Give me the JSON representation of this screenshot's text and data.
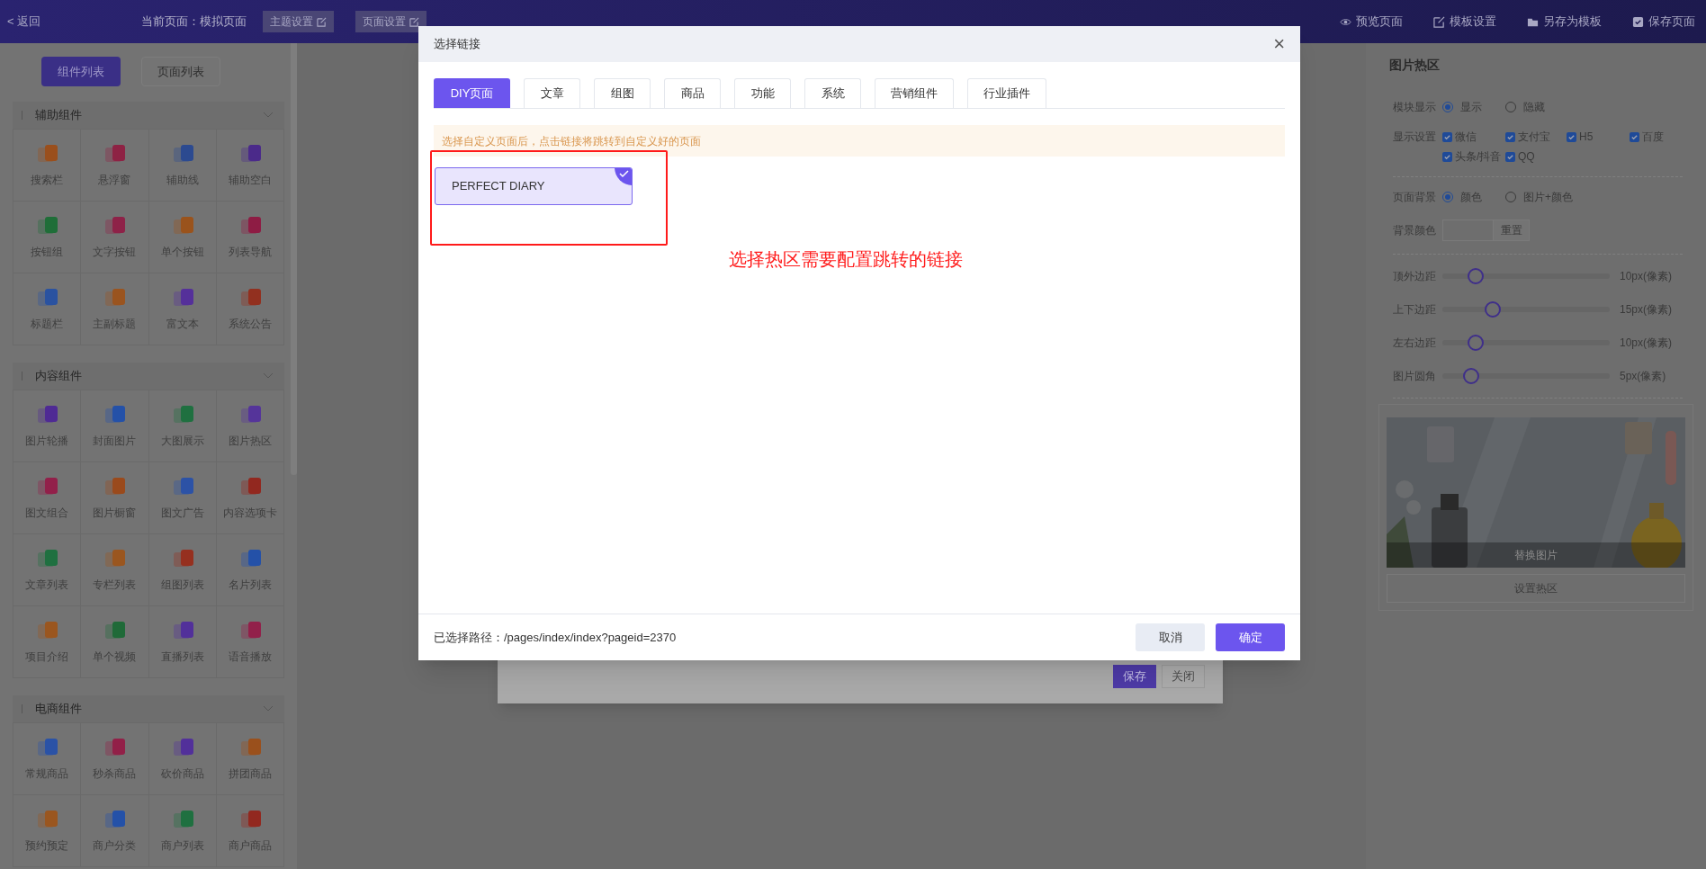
{
  "top_bar": {
    "back": "< 返回",
    "current_page": "当前页面：模拟页面",
    "page_buttons": [
      "主题设置",
      "页面设置"
    ],
    "actions": [
      {
        "label": "预览页面",
        "kind": "eye"
      },
      {
        "label": "模板设置",
        "kind": "edit"
      },
      {
        "label": "另存为模板",
        "kind": "folder"
      },
      {
        "label": "保存页面",
        "kind": "check"
      }
    ]
  },
  "sidebar": {
    "tabs": [
      {
        "label": "组件列表",
        "selected": true
      },
      {
        "label": "页面列表",
        "selected": false
      }
    ],
    "sections": [
      {
        "title": "辅助组件",
        "expanded": true,
        "items": [
          {
            "label": "搜索栏",
            "color": "#9a4f1c"
          },
          {
            "label": "悬浮窗",
            "color": "#8e2244"
          },
          {
            "label": "辅助线",
            "color": "#2c4a90"
          },
          {
            "label": "辅助空白",
            "color": "#4b2a8a"
          },
          {
            "label": "按钮组",
            "color": "#1f6e38"
          },
          {
            "label": "文字按钮",
            "color": "#8e2248"
          },
          {
            "label": "单个按钮",
            "color": "#9a531c"
          },
          {
            "label": "列表导航",
            "color": "#8e1c44"
          },
          {
            "label": "标题栏",
            "color": "#2a52a0"
          },
          {
            "label": "主副标题",
            "color": "#9a541f"
          },
          {
            "label": "富文本",
            "color": "#55309a"
          },
          {
            "label": "系统公告",
            "color": "#92301f"
          }
        ]
      },
      {
        "title": "内容组件",
        "expanded": true,
        "items": [
          {
            "label": "图片轮播",
            "color": "#4f2a94"
          },
          {
            "label": "封面图片",
            "color": "#2451a8"
          },
          {
            "label": "大图展示",
            "color": "#1f7040"
          },
          {
            "label": "图片热区",
            "color": "#55349a"
          },
          {
            "label": "图文组合",
            "color": "#92204a"
          },
          {
            "label": "图片橱窗",
            "color": "#9a4a1c"
          },
          {
            "label": "图文广告",
            "color": "#2c52a6"
          },
          {
            "label": "内容选项卡",
            "color": "#92281f"
          },
          {
            "label": "文章列表",
            "color": "#1f7040"
          },
          {
            "label": "专栏列表",
            "color": "#9a561f"
          },
          {
            "label": "组图列表",
            "color": "#96301f"
          },
          {
            "label": "名片列表",
            "color": "#2451a8"
          },
          {
            "label": "项目介绍",
            "color": "#9a561f"
          },
          {
            "label": "单个视频",
            "color": "#1f6a38"
          },
          {
            "label": "直播列表",
            "color": "#52309a"
          },
          {
            "label": "语音播放",
            "color": "#92204a"
          }
        ]
      },
      {
        "title": "电商组件",
        "expanded": true,
        "items": [
          {
            "label": "常规商品",
            "color": "#2a52a6"
          },
          {
            "label": "秒杀商品",
            "color": "#922048"
          },
          {
            "label": "砍价商品",
            "color": "#52309a"
          },
          {
            "label": "拼团商品",
            "color": "#9a501c"
          },
          {
            "label": "预约预定",
            "color": "#9a561f"
          },
          {
            "label": "商户分类",
            "color": "#2451a8"
          },
          {
            "label": "商户列表",
            "color": "#1f7040"
          },
          {
            "label": "商户商品",
            "color": "#92281f"
          }
        ]
      }
    ]
  },
  "background_dialog": {
    "buttons": [
      {
        "label": "保存",
        "kind": "primary"
      },
      {
        "label": "关闭",
        "kind": "default"
      }
    ]
  },
  "modal": {
    "title": "选择链接",
    "close": "×",
    "tabs": [
      {
        "label": "DIY页面",
        "selected": true
      },
      {
        "label": "文章",
        "selected": false
      },
      {
        "label": "组图",
        "selected": false
      },
      {
        "label": "商品",
        "selected": false
      },
      {
        "label": "功能",
        "selected": false
      },
      {
        "label": "系统",
        "selected": false
      },
      {
        "label": "营销组件",
        "selected": false
      },
      {
        "label": "行业插件",
        "selected": false
      }
    ],
    "notice": "选择自定义页面后，点击链接将跳转到自定义好的页面",
    "pages": [
      {
        "label": "PERFECT DIARY",
        "selected": true
      }
    ],
    "annotation": "选择热区需要配置跳转的链接",
    "path": "已选择路径：/pages/index/index?pageid=2370",
    "buttons": [
      {
        "label": "取消",
        "kind": "secondary"
      },
      {
        "label": "确定",
        "kind": "primary"
      }
    ]
  },
  "settings_panel": {
    "title": "图片热区",
    "groups": [
      {
        "rows": [
          {
            "kind": "radio",
            "label": "模块显示",
            "options": [
              {
                "label": "显示",
                "selected": true
              },
              {
                "label": "隐藏",
                "selected": false
              }
            ]
          },
          {
            "kind": "checkbox",
            "label": "显示设置",
            "options": [
              {
                "label": "微信",
                "checked": true
              },
              {
                "label": "支付宝",
                "checked": true
              },
              {
                "label": "H5",
                "checked": true
              },
              {
                "label": "百度",
                "checked": true
              },
              {
                "label": "头条/抖音",
                "checked": true
              },
              {
                "label": "QQ",
                "checked": true
              }
            ]
          }
        ]
      },
      {
        "rows": [
          {
            "kind": "radio",
            "label": "页面背景",
            "options": [
              {
                "label": "颜色",
                "selected": true
              },
              {
                "label": "图片+颜色",
                "selected": false
              }
            ]
          },
          {
            "kind": "color",
            "label": "背景颜色",
            "button": "重置"
          }
        ]
      },
      {
        "rows": [
          {
            "kind": "slider",
            "label": "顶外边距",
            "level": 0.2,
            "reading": "10px(像素)"
          },
          {
            "kind": "slider",
            "label": "上下边距",
            "level": 0.3,
            "reading": "15px(像素)"
          },
          {
            "kind": "slider",
            "label": "左右边距",
            "level": 0.2,
            "reading": "10px(像素)"
          },
          {
            "kind": "slider",
            "label": "图片圆角",
            "level": 0.17,
            "reading": "5px(像素)"
          }
        ]
      }
    ],
    "image": {
      "kind": "picture",
      "overlay": "替换图片"
    },
    "hotspot_button": "设置热区"
  }
}
